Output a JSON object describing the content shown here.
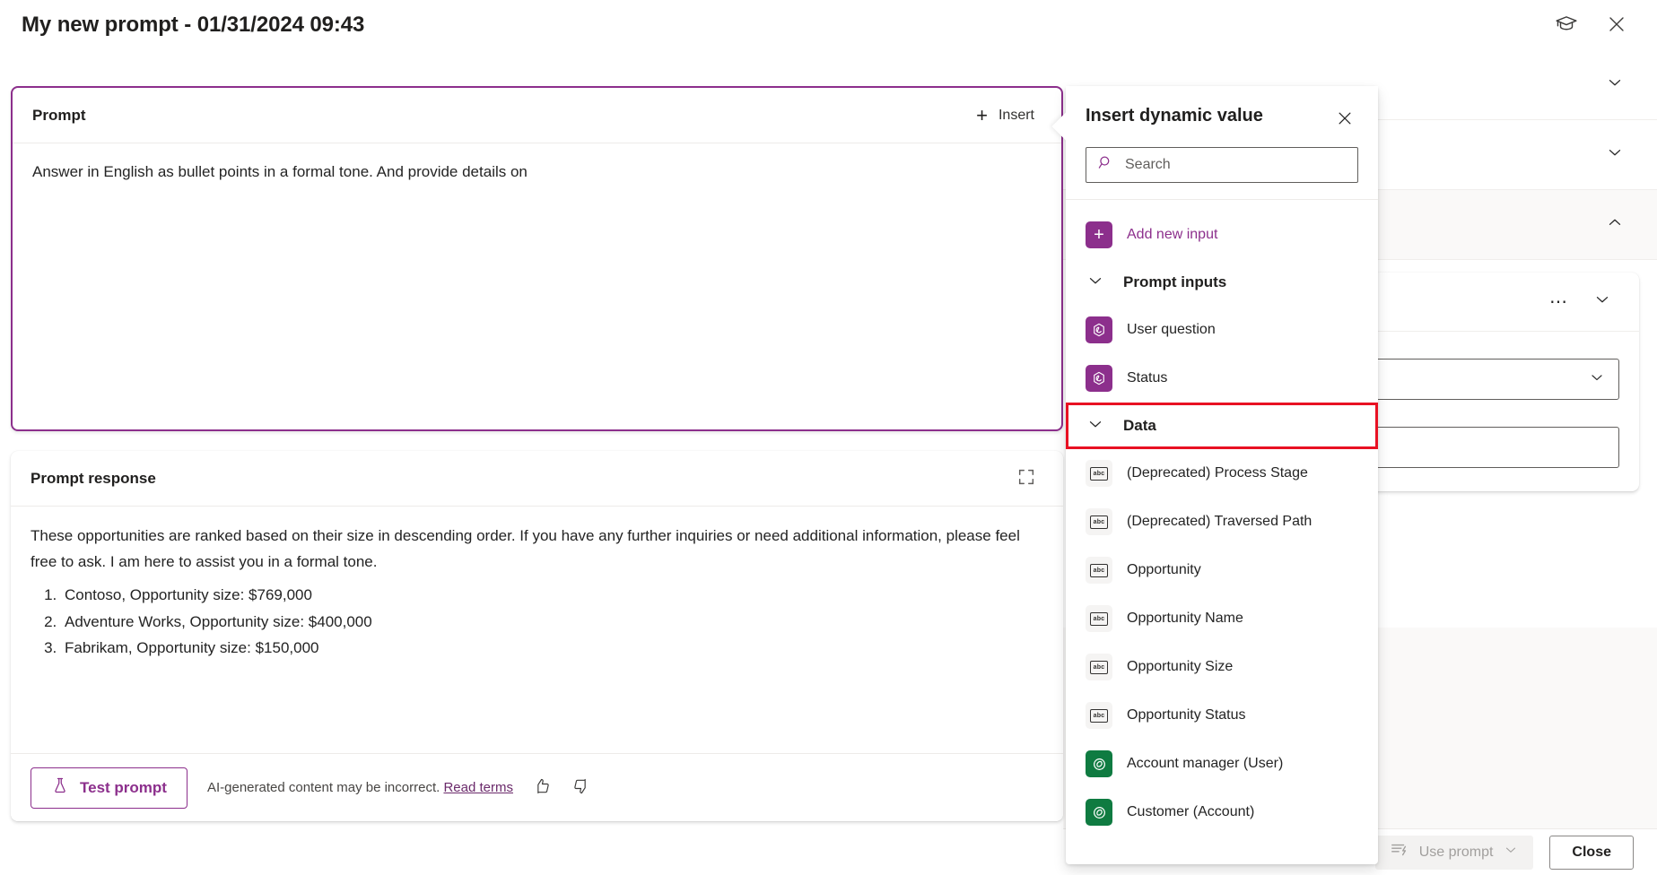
{
  "window": {
    "title": "My new prompt - 01/31/2024 09:43",
    "learn_icon": "graduation-cap-icon",
    "close_icon": "close-icon"
  },
  "prompt_card": {
    "header": "Prompt",
    "insert_label": "Insert",
    "insert_icon": "plus-icon",
    "text": "Answer in English as bullet points in a formal tone. And provide details on"
  },
  "response_card": {
    "header": "Prompt response",
    "expand_icon": "expand-icon",
    "paragraph": "These opportunities are ranked based on their size in descending order. If you have any further inquiries or need additional information, please feel free to ask. I am here to assist you in a formal tone.",
    "list": [
      "Contoso, Opportunity size: $769,000",
      "Adventure Works, Opportunity size: $400,000",
      "Fabrikam, Opportunity size: $150,000"
    ],
    "test_button": "Test prompt",
    "test_icon": "flask-icon",
    "disclaimer": "AI-generated content may be incorrect.",
    "disclaimer_link": "Read terms",
    "thumbs_up_icon": "thumbs-up-icon",
    "thumbs_down_icon": "thumbs-down-icon"
  },
  "flyout": {
    "title": "Insert dynamic value",
    "close_icon": "close-icon",
    "search": {
      "placeholder": "Search",
      "value": "",
      "icon": "search-icon"
    },
    "add_new_input": {
      "label": "Add new input",
      "icon": "plus-icon"
    },
    "groups": [
      {
        "label": "Prompt inputs",
        "chevron": "chevron-down-icon",
        "highlighted": false,
        "items": [
          {
            "label": "User question",
            "icon": "copilot-hexagon-icon",
            "kind": "purple"
          },
          {
            "label": "Status",
            "icon": "copilot-hexagon-icon",
            "kind": "purple"
          }
        ]
      },
      {
        "label": "Data",
        "chevron": "chevron-down-icon",
        "highlighted": true,
        "items": [
          {
            "label": "(Deprecated) Process Stage",
            "icon": "text-abc-icon",
            "kind": "gray"
          },
          {
            "label": "(Deprecated) Traversed Path",
            "icon": "text-abc-icon",
            "kind": "gray"
          },
          {
            "label": "Opportunity",
            "icon": "text-abc-icon",
            "kind": "gray"
          },
          {
            "label": "Opportunity Name",
            "icon": "text-abc-icon",
            "kind": "gray"
          },
          {
            "label": "Opportunity Size",
            "icon": "text-abc-icon",
            "kind": "gray"
          },
          {
            "label": "Opportunity Status",
            "icon": "text-abc-icon",
            "kind": "gray"
          },
          {
            "label": "Account manager (User)",
            "icon": "lookup-swirl-icon",
            "kind": "green"
          },
          {
            "label": "Customer (Account)",
            "icon": "lookup-swirl-icon",
            "kind": "green"
          }
        ]
      }
    ]
  },
  "bottom_bar": {
    "use_prompt_label": "Use prompt",
    "use_prompt_icon": "insert-prompt-icon",
    "use_prompt_chevron": "chevron-down-icon",
    "close_label": "Close"
  },
  "background_panel": {
    "sections": [
      {
        "chevron": "chevron-down-icon",
        "shaded": false
      },
      {
        "chevron": "chevron-down-icon",
        "shaded": false
      },
      {
        "chevron": "chevron-up-icon",
        "shaded": true
      }
    ],
    "card": {
      "more_icon": "ellipsis-icon",
      "chevron": "chevron-down-icon"
    }
  },
  "colors": {
    "accent_purple": "#8c2f8c",
    "green": "#0f7b41",
    "highlight_red": "#e81123",
    "text": "#242424"
  }
}
